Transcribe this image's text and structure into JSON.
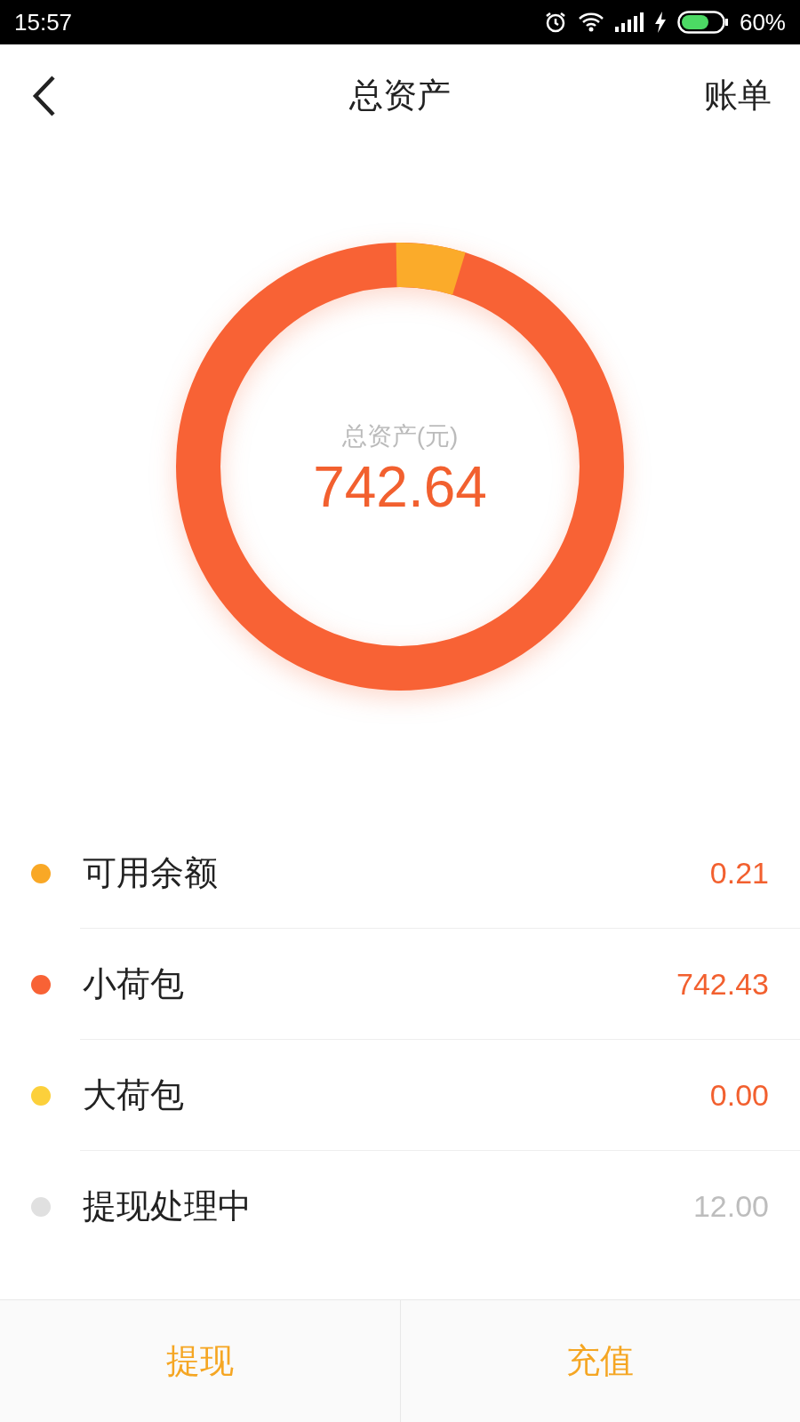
{
  "status_bar": {
    "time": "15:57",
    "battery": "60%"
  },
  "header": {
    "title": "总资产",
    "action": "账单"
  },
  "summary": {
    "label": "总资产(元)",
    "value": "742.64"
  },
  "items": [
    {
      "label": "可用余额",
      "value": "0.21",
      "color": "#f9a826",
      "muted": false
    },
    {
      "label": "小荷包",
      "value": "742.43",
      "color": "#f86235",
      "muted": false
    },
    {
      "label": "大荷包",
      "value": "0.00",
      "color": "#fcd03b",
      "muted": false
    },
    {
      "label": "提现处理中",
      "value": "12.00",
      "color": "#e0e0e0",
      "muted": true
    }
  ],
  "actions": [
    "提现",
    "充值"
  ]
}
